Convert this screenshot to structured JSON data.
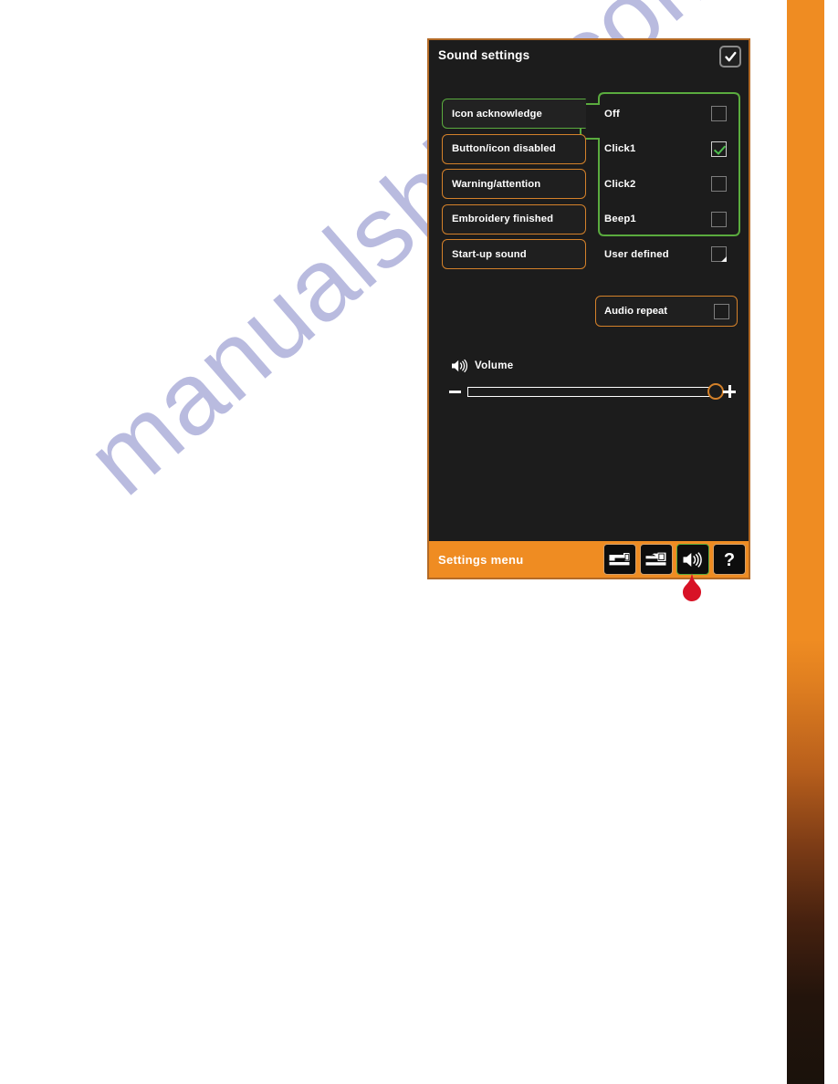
{
  "watermark": {
    "text": "manualshive.com"
  },
  "colors": {
    "accent_orange": "#ef8c22",
    "panel_bg": "#1c1c1c",
    "selected_green": "#5aab3e",
    "button_border_orange": "#d4812a",
    "pointer_red": "#d81226",
    "check_green": "#4fbf4f"
  },
  "dialog": {
    "title": "Sound settings",
    "ok_button": {
      "name": "ok-button",
      "icon": "check-icon"
    },
    "categories": [
      {
        "label": "Icon acknowledge",
        "selected": true
      },
      {
        "label": "Button/icon disabled",
        "selected": false
      },
      {
        "label": "Warning/attention",
        "selected": false
      },
      {
        "label": "Embroidery finished",
        "selected": false
      },
      {
        "label": "Start-up sound",
        "selected": false
      }
    ],
    "options": [
      {
        "label": "Off",
        "checked": false,
        "corner_marker": false
      },
      {
        "label": "Click1",
        "checked": true,
        "corner_marker": false
      },
      {
        "label": "Click2",
        "checked": false,
        "corner_marker": false
      },
      {
        "label": "Beep1",
        "checked": false,
        "corner_marker": false
      },
      {
        "label": "User defined",
        "checked": false,
        "corner_marker": true
      }
    ],
    "audio_repeat": {
      "label": "Audio repeat",
      "checked": false
    },
    "volume": {
      "label": "Volume",
      "icon": "speaker-icon",
      "value": 100,
      "min": 0,
      "max": 100,
      "decrease_label": "−",
      "increase_label": "+"
    },
    "settings_bar": {
      "title": "Settings menu",
      "buttons": [
        {
          "name": "sewing-machine-icon",
          "active": false
        },
        {
          "name": "embroidery-machine-icon",
          "active": false
        },
        {
          "name": "speaker-icon",
          "active": true
        },
        {
          "name": "help-icon",
          "label": "?",
          "active": false
        }
      ]
    }
  },
  "annotation": {
    "pointer": "red-teardrop-pointer"
  }
}
